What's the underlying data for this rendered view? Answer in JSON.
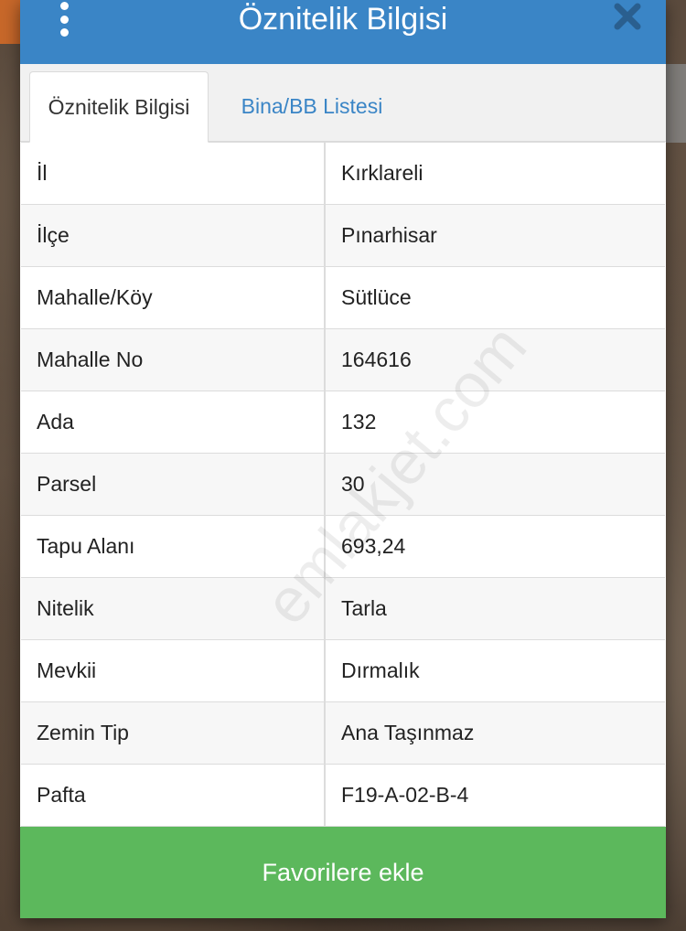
{
  "dialog": {
    "title": "Öznitelik Bilgisi"
  },
  "tabs": [
    {
      "label": "Öznitelik Bilgisi",
      "active": true
    },
    {
      "label": "Bina/BB Listesi",
      "active": false
    }
  ],
  "attributes": [
    {
      "key": "İl",
      "value": "Kırklareli"
    },
    {
      "key": "İlçe",
      "value": "Pınarhisar"
    },
    {
      "key": "Mahalle/Köy",
      "value": "Sütlüce"
    },
    {
      "key": "Mahalle No",
      "value": "164616"
    },
    {
      "key": "Ada",
      "value": "132"
    },
    {
      "key": "Parsel",
      "value": "30"
    },
    {
      "key": "Tapu Alanı",
      "value": "693,24"
    },
    {
      "key": "Nitelik",
      "value": "Tarla"
    },
    {
      "key": "Mevkii",
      "value": "Dırmalık"
    },
    {
      "key": "Zemin Tip",
      "value": "Ana Taşınmaz"
    },
    {
      "key": "Pafta",
      "value": "F19-A-02-B-4"
    }
  ],
  "footer": {
    "favorite_label": "Favorilere ekle"
  },
  "watermark": "emlakjet.com",
  "colors": {
    "header": "#3a85c6",
    "link": "#3a85c6",
    "button": "#5cb85c"
  },
  "icons": {
    "menu": "vertical-dots-icon",
    "close": "close-icon"
  }
}
